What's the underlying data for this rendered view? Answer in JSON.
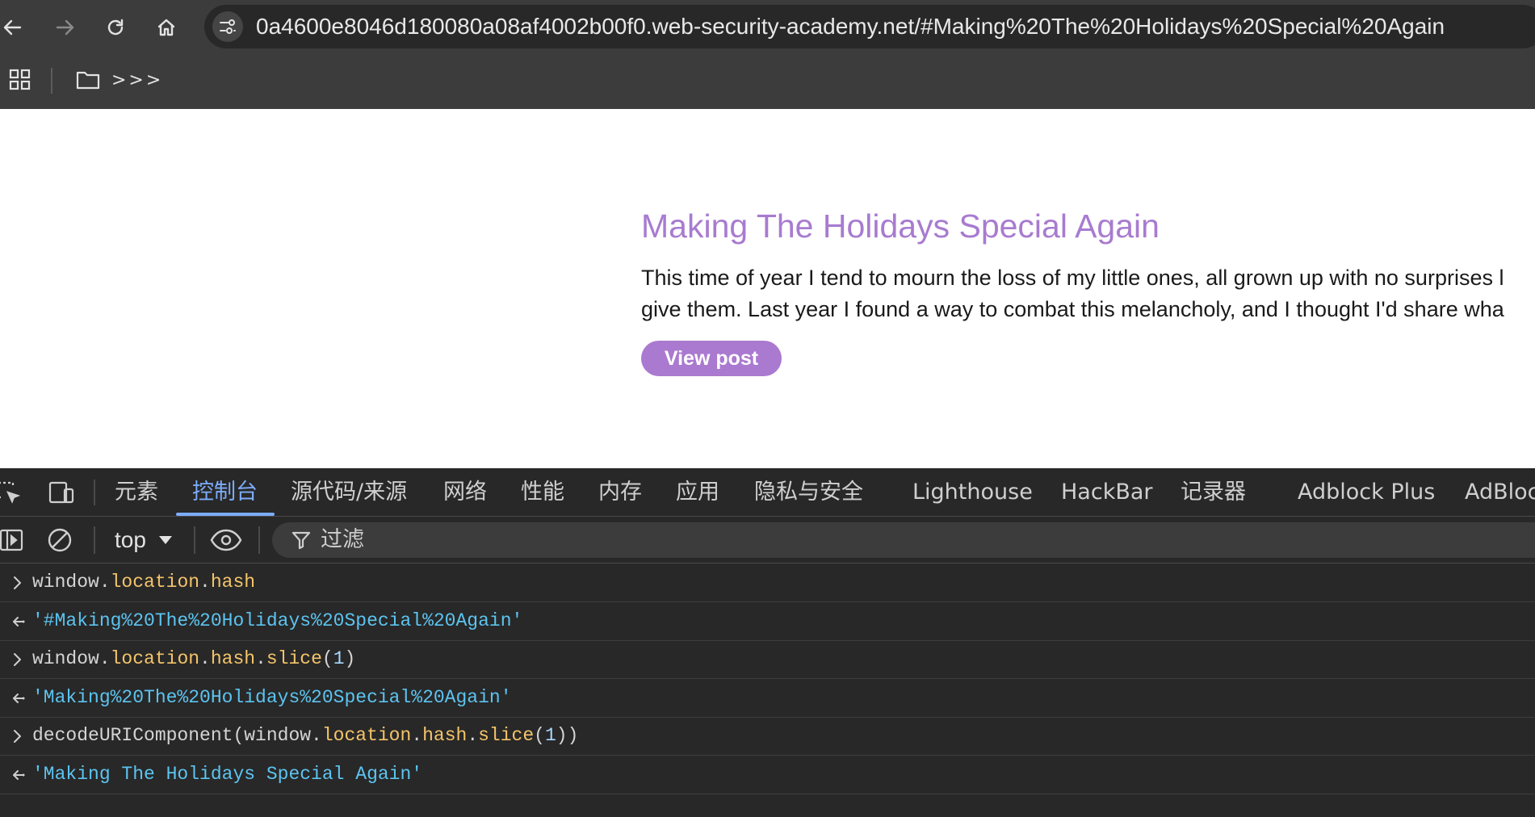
{
  "browser": {
    "url": "0a4600e8046d180080a08af4002b00f0.web-security-academy.net/#Making%20The%20Holidays%20Special%20Again",
    "bookmarks_more": ">>>"
  },
  "post": {
    "title": "Making The Holidays Special Again",
    "line1": "This time of year I tend to mourn the loss of my little ones, all grown up with no surprises l",
    "line2": "give them. Last year I found a way to combat this melancholy, and I thought I'd share wha",
    "button": "View post"
  },
  "devtools": {
    "tabs": [
      "元素",
      "控制台",
      "源代码/来源",
      "网络",
      "性能",
      "内存",
      "应用",
      "隐私与安全",
      "Lighthouse",
      "HackBar",
      "记录器",
      "Adblock Plus",
      "AdBloc"
    ],
    "active_tab": "控制台",
    "context": "top",
    "filter_placeholder": "过滤",
    "console": [
      {
        "kind": "input",
        "tokens": [
          {
            "t": "window.",
            "c": "plain"
          },
          {
            "t": "location",
            "c": "prop"
          },
          {
            "t": ".",
            "c": "plain"
          },
          {
            "t": "hash",
            "c": "prop"
          }
        ]
      },
      {
        "kind": "output",
        "tokens": [
          {
            "t": "'#Making%20The%20Holidays%20Special%20Again'",
            "c": "str"
          }
        ]
      },
      {
        "kind": "input",
        "tokens": [
          {
            "t": "window.",
            "c": "plain"
          },
          {
            "t": "location",
            "c": "prop"
          },
          {
            "t": ".",
            "c": "plain"
          },
          {
            "t": "hash",
            "c": "prop"
          },
          {
            "t": ".",
            "c": "plain"
          },
          {
            "t": "slice",
            "c": "prop"
          },
          {
            "t": "(",
            "c": "plain"
          },
          {
            "t": "1",
            "c": "num"
          },
          {
            "t": ")",
            "c": "plain"
          }
        ]
      },
      {
        "kind": "output",
        "tokens": [
          {
            "t": "'Making%20The%20Holidays%20Special%20Again'",
            "c": "str"
          }
        ]
      },
      {
        "kind": "input",
        "tokens": [
          {
            "t": "decodeURIComponent(window.",
            "c": "plain"
          },
          {
            "t": "location",
            "c": "prop"
          },
          {
            "t": ".",
            "c": "plain"
          },
          {
            "t": "hash",
            "c": "prop"
          },
          {
            "t": ".",
            "c": "plain"
          },
          {
            "t": "slice",
            "c": "prop"
          },
          {
            "t": "(",
            "c": "plain"
          },
          {
            "t": "1",
            "c": "num"
          },
          {
            "t": "))",
            "c": "plain"
          }
        ]
      },
      {
        "kind": "output",
        "tokens": [
          {
            "t": "'Making The Holidays Special Again'",
            "c": "str"
          }
        ]
      }
    ]
  },
  "icons": {
    "back": "arrow-left-icon",
    "forward": "arrow-right-icon",
    "reload": "reload-icon",
    "home": "home-icon",
    "site_info": "tune-icon",
    "apps": "apps-grid-icon",
    "folder": "folder-icon",
    "inspect": "inspect-element-icon",
    "device": "device-toolbar-icon",
    "sidebar": "sidebar-toggle-icon",
    "clear": "clear-console-icon",
    "live_expression": "eye-icon",
    "filter": "filter-icon"
  },
  "colors": {
    "accent": "#a87bd0",
    "button": "#aa79d0",
    "active_tab": "#7cacf8",
    "string": "#5cc4f0",
    "property": "#f4c46a"
  }
}
